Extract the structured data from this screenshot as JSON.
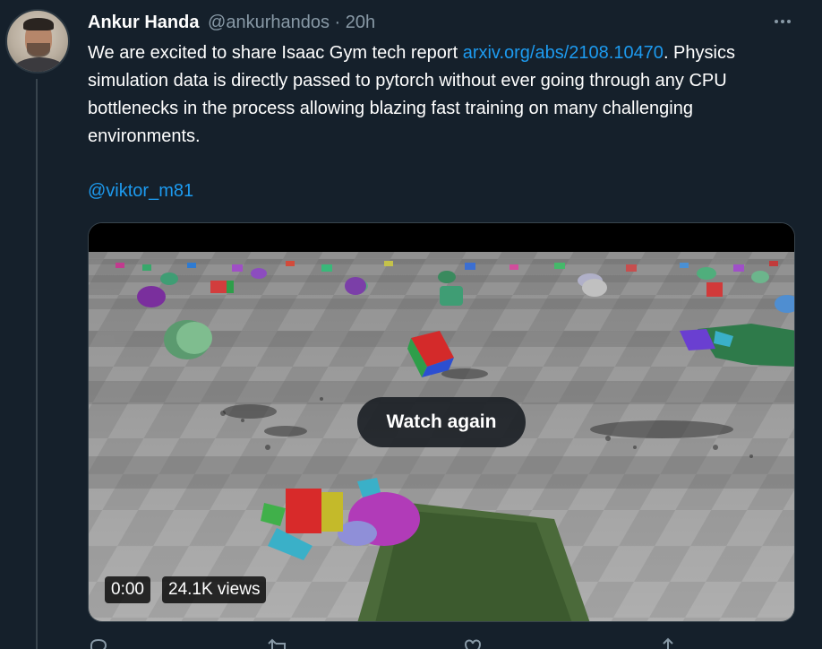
{
  "author": {
    "name": "Ankur Handa",
    "handle": "@ankurhandos",
    "separator": "·",
    "time": "20h"
  },
  "tweet": {
    "text_before_link": "We are excited to share Isaac Gym tech report ",
    "link_text": "arxiv.org/abs/2108.10470",
    "text_after_link": ". Physics simulation data is directly passed to pytorch without ever going through any CPU bottlenecks in the process allowing blazing fast training on many challenging environments.",
    "mention": "@viktor_m81"
  },
  "media": {
    "watch_again_label": "Watch again",
    "time_badge": "0:00",
    "views_badge": "24.1K views"
  },
  "icons": {
    "more": "more-icon",
    "reply": "reply-icon",
    "retweet": "retweet-icon",
    "like": "like-icon",
    "share": "share-icon"
  },
  "colors": {
    "background": "#15202b",
    "link": "#1d9bf0",
    "secondary_text": "#8899a6"
  }
}
